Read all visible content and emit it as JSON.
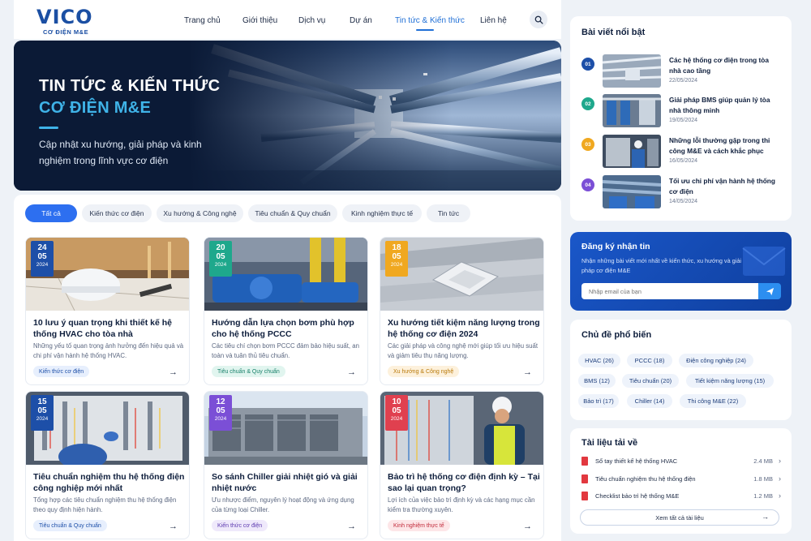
{
  "header": {
    "logo_text": "VICO",
    "logo_sub": "CƠ ĐIỆN M&E",
    "nav": [
      "Trang chủ",
      "Giới thiệu",
      "Dịch vụ",
      "Dự án",
      "Tin tức & Kiến thức",
      "Liên hệ"
    ],
    "active_nav": "Tin tức & Kiến thức"
  },
  "hero": {
    "title_line1": "TIN TỨC & KIẾN THỨC",
    "title_line2": "CƠ ĐIỆN M&E",
    "description": "Cập nhật xu hướng, giải pháp và kinh nghiệm trong lĩnh vực cơ điện"
  },
  "filters": [
    "Tất cả",
    "Kiến thức cơ điện",
    "Xu hướng & Công nghệ",
    "Tiêu chuẩn & Quy chuẩn",
    "Kinh nghiệm thực tế",
    "Tin tức"
  ],
  "articles": [
    {
      "day": "24",
      "month": "05",
      "year": "2024",
      "title": "10 lưu ý quan trọng khi thiết kế hệ thống HVAC cho tòa nhà",
      "desc": "Những yếu tố quan trọng ảnh hưởng đến hiệu quả và chi phí vận hành hệ thống HVAC.",
      "tag": "Kiến thức cơ điện",
      "date_color": "#1d4fa8",
      "tag_bg": "#e7effd",
      "tag_color": "#1d4fa8"
    },
    {
      "day": "20",
      "month": "05",
      "year": "2024",
      "title": "Hướng dẫn lựa chọn bơm phù hợp cho hệ thống PCCC",
      "desc": "Các tiêu chí chọn bơm PCCC đảm bảo hiệu suất, an toàn và tuân thủ tiêu chuẩn.",
      "tag": "Tiêu chuẩn & Quy chuẩn",
      "date_color": "#1ea88c",
      "tag_bg": "#e1f5ef",
      "tag_color": "#17806a"
    },
    {
      "day": "18",
      "month": "05",
      "year": "2024",
      "title": "Xu hướng tiết kiệm năng lượng trong hệ thống cơ điện 2024",
      "desc": "Các giải pháp và công nghệ mới giúp tối ưu hiệu suất và giảm tiêu thụ năng lượng.",
      "tag": "Xu hướng & Công nghệ",
      "date_color": "#f0a820",
      "tag_bg": "#fdf1dc",
      "tag_color": "#b97a0a"
    },
    {
      "day": "15",
      "month": "05",
      "year": "2024",
      "title": "Tiêu chuẩn nghiệm thu hệ thống điện công nghiệp mới nhất",
      "desc": "Tổng hợp các tiêu chuẩn nghiệm thu hệ thống điện theo quy định hiện hành.",
      "tag": "Tiêu chuẩn & Quy chuẩn",
      "date_color": "#1d4fa8",
      "tag_bg": "#e7effd",
      "tag_color": "#1d4fa8"
    },
    {
      "day": "12",
      "month": "05",
      "year": "2024",
      "title": "So sánh Chiller giải nhiệt gió và giải nhiệt nước",
      "desc": "Ưu nhược điểm, nguyên lý hoạt động và ứng dụng của từng loại Chiller.",
      "tag": "Kiến thức cơ điện",
      "date_color": "#7b4fd6",
      "tag_bg": "#efe9fb",
      "tag_color": "#5d3ab0"
    },
    {
      "day": "10",
      "month": "05",
      "year": "2024",
      "title": "Bảo trì hệ thống cơ điện định kỳ – Tại sao lại quan trọng?",
      "desc": "Lợi ích của việc bảo trì định kỳ và các hạng mục cần kiểm tra thường xuyên.",
      "tag": "Kinh nghiệm thực tế",
      "date_color": "#e0404f",
      "tag_bg": "#fde6e8",
      "tag_color": "#c12a3a"
    }
  ],
  "featured": {
    "heading": "Bài viết nổi bật",
    "items": [
      {
        "num": "01",
        "title": "Các hệ thống cơ điện trong tòa nhà cao tầng",
        "date": "22/05/2024",
        "color": "#1d4fa8"
      },
      {
        "num": "02",
        "title": "Giải pháp BMS giúp quản lý tòa nhà thông minh",
        "date": "19/05/2024",
        "color": "#1ea88c"
      },
      {
        "num": "03",
        "title": "Những lỗi thường gặp trong thi công M&E và cách khắc phục",
        "date": "16/05/2024",
        "color": "#f0a820"
      },
      {
        "num": "04",
        "title": "Tối ưu chi phí vận hành hệ thống cơ điện",
        "date": "14/05/2024",
        "color": "#7b4fd6"
      }
    ]
  },
  "newsletter": {
    "title": "Đăng ký nhận tin",
    "desc": "Nhận những bài viết mới nhất về kiến thức, xu hướng và giải pháp cơ điện M&E",
    "placeholder": "Nhập email của bạn"
  },
  "topics": {
    "heading": "Chủ đề phổ biến",
    "items": [
      "HVAC (26)",
      "PCCC (18)",
      "Điện công nghiệp (24)",
      "BMS (12)",
      "Tiêu chuẩn (20)",
      "Tiết kiệm năng lượng (15)",
      "Bảo trì (17)",
      "Chiller (14)",
      "Thi công M&E (22)"
    ]
  },
  "downloads": {
    "heading": "Tài liệu tải về",
    "items": [
      {
        "name": "Sổ tay thiết kế hệ thống HVAC",
        "size": "2.4 MB"
      },
      {
        "name": "Tiêu chuẩn nghiệm thu hệ thống điện",
        "size": "1.8 MB"
      },
      {
        "name": "Checklist bảo trì hệ thống M&E",
        "size": "1.2 MB"
      }
    ],
    "view_all": "Xem tất cả tài liệu"
  }
}
